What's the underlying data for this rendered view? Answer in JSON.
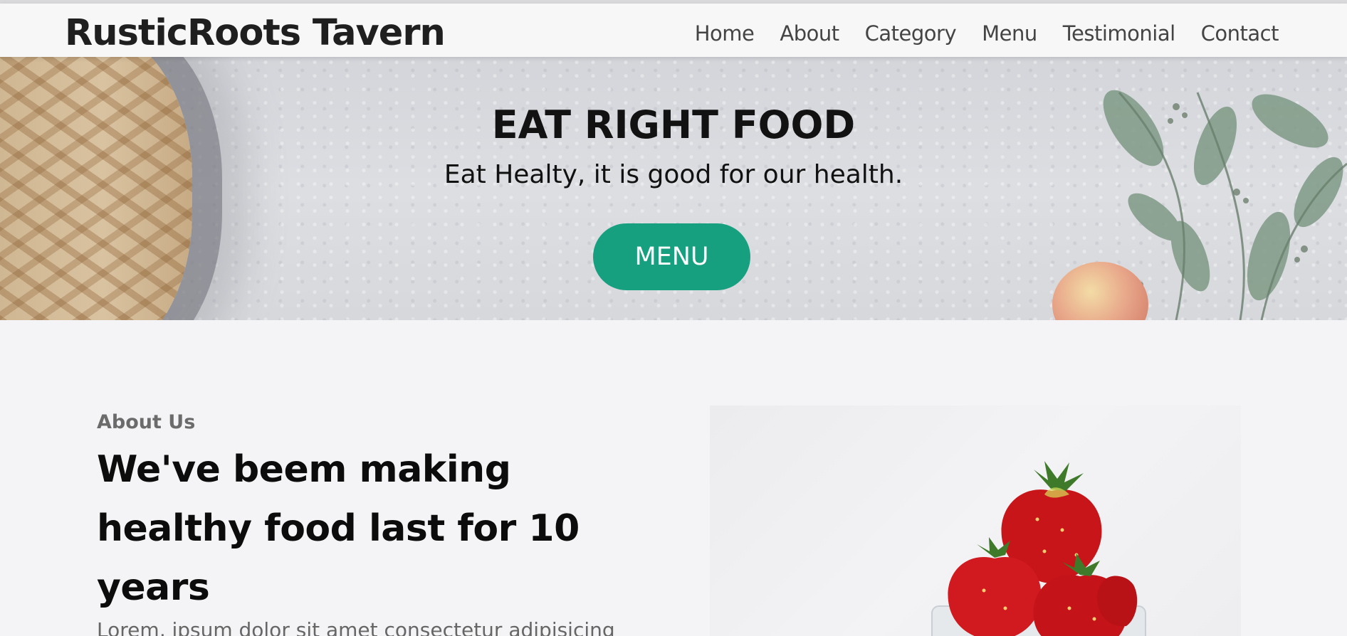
{
  "header": {
    "logo": "RusticRoots Tavern",
    "nav": [
      "Home",
      "About",
      "Category",
      "Menu",
      "Testimonial",
      "Contact"
    ]
  },
  "hero": {
    "title": "EAT RIGHT FOOD",
    "subtitle": "Eat Healty, it is good for our health.",
    "button_label": "MENU",
    "button_color": "#17a07f"
  },
  "about": {
    "eyebrow": "About Us",
    "heading": "We've beem making healthy food last for 10 years",
    "body": "Lorem, ipsum dolor sit amet consectetur adipisicing"
  },
  "icons": {
    "hero_decor": [
      "pie-image",
      "leaves-image",
      "apple-image"
    ],
    "about_image": "strawberries-image"
  }
}
